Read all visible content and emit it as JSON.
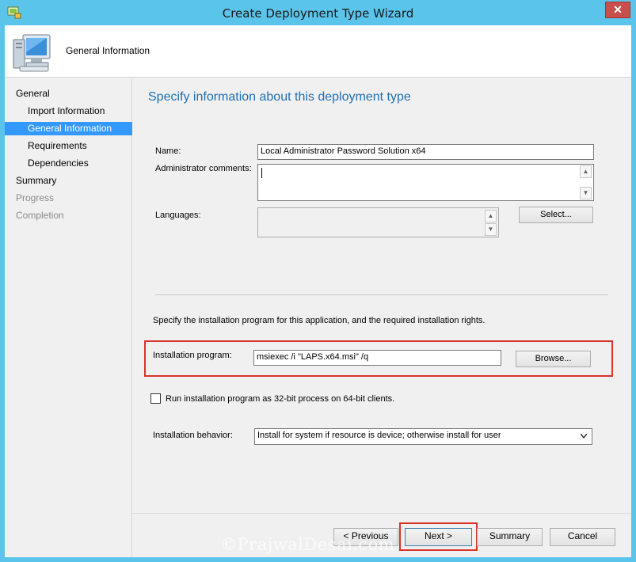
{
  "window": {
    "title": "Create Deployment Type Wizard",
    "close_glyph": "✕",
    "close_color": "#c7504c",
    "frame_color": "#5bc4ea"
  },
  "header": {
    "title": "General Information"
  },
  "nav": {
    "items": [
      {
        "label": "General",
        "level": 0,
        "state": "normal"
      },
      {
        "label": "Import Information",
        "level": 1,
        "state": "normal"
      },
      {
        "label": "General Information",
        "level": 1,
        "state": "selected"
      },
      {
        "label": "Requirements",
        "level": 1,
        "state": "normal"
      },
      {
        "label": "Dependencies",
        "level": 1,
        "state": "normal"
      },
      {
        "label": "Summary",
        "level": 0,
        "state": "normal"
      },
      {
        "label": "Progress",
        "level": 0,
        "state": "disabled"
      },
      {
        "label": "Completion",
        "level": 0,
        "state": "disabled"
      }
    ]
  },
  "main": {
    "page_title": "Specify information about this deployment type",
    "name_label": "Name:",
    "name_value": "Local Administrator Password Solution x64",
    "comments_label": "Administrator comments:",
    "comments_value": "",
    "languages_label": "Languages:",
    "languages_value": "",
    "select_button": "Select...",
    "install_hint": "Specify the installation program for this application, and the required installation rights.",
    "install_program_label": "Installation program:",
    "install_program_value": "msiexec /i \"LAPS.x64.msi\" /q",
    "browse_button": "Browse...",
    "run32_label": "Run installation program as 32-bit process on 64-bit clients.",
    "run32_checked": false,
    "behavior_label": "Installation behavior:",
    "behavior_value": "Install for system if resource is device; otherwise install for user"
  },
  "footer": {
    "previous": "< Previous",
    "next": "Next >",
    "summary": "Summary",
    "cancel": "Cancel"
  },
  "watermark": "©PrajwalDesai.com",
  "icons": {
    "app": "wizard-app-icon",
    "header": "computer-monitor-icon",
    "scroll_up": "▲",
    "scroll_down": "▼"
  },
  "highlight_color": "#d9342b",
  "selection_color": "#3399ff",
  "title_color": "#1f6fb2"
}
